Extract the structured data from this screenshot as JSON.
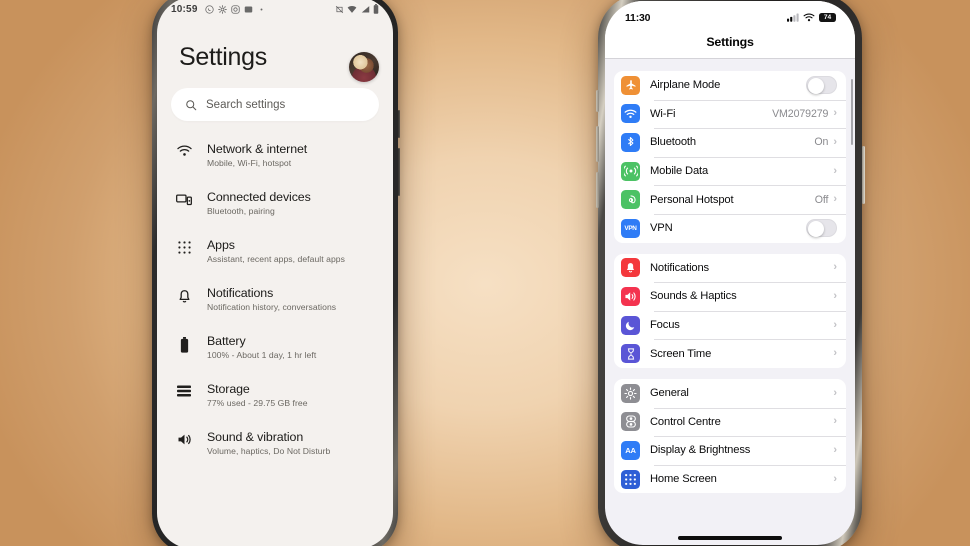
{
  "background": {
    "accent": "#cc935c",
    "center": "#f5ddc0"
  },
  "android": {
    "status_bar": {
      "time": "10:59",
      "notification_icons": [
        "whatsapp-icon",
        "settings-gear-icon",
        "instagram-icon",
        "app-icon",
        "more-dot-icon"
      ],
      "right_icons": [
        "vibrate-off-icon",
        "wifi-icon",
        "signal-icon",
        "battery-icon"
      ]
    },
    "avatar": "user-avatar",
    "title": "Settings",
    "search": {
      "placeholder": "Search settings",
      "icon": "search-icon"
    },
    "items": [
      {
        "icon": "wifi-icon",
        "title": "Network & internet",
        "subtitle": "Mobile, Wi-Fi, hotspot"
      },
      {
        "icon": "devices-icon",
        "title": "Connected devices",
        "subtitle": "Bluetooth, pairing"
      },
      {
        "icon": "apps-grid-icon",
        "title": "Apps",
        "subtitle": "Assistant, recent apps, default apps"
      },
      {
        "icon": "bell-icon",
        "title": "Notifications",
        "subtitle": "Notification history, conversations"
      },
      {
        "icon": "battery-icon",
        "title": "Battery",
        "subtitle": "100% - About 1 day, 1 hr left"
      },
      {
        "icon": "storage-icon",
        "title": "Storage",
        "subtitle": "77% used - 29.75 GB free"
      },
      {
        "icon": "volume-icon",
        "title": "Sound & vibration",
        "subtitle": "Volume, haptics, Do Not Disturb"
      }
    ]
  },
  "iphone": {
    "status_bar": {
      "time": "11:30",
      "signal_icon": "cellular-signal-icon",
      "wifi_icon": "wifi-icon",
      "battery_level": "74"
    },
    "nav_title": "Settings",
    "groups": [
      {
        "rows": [
          {
            "icon": "airplane-icon",
            "icon_color": "#ef9035",
            "label": "Airplane Mode",
            "control": "toggle",
            "value": "",
            "state": "off"
          },
          {
            "icon": "wifi-icon",
            "icon_color": "#2f7cf6",
            "label": "Wi-Fi",
            "control": "chevron",
            "value": "VM2079279"
          },
          {
            "icon": "bluetooth-icon",
            "icon_color": "#2f7cf6",
            "label": "Bluetooth",
            "control": "chevron",
            "value": "On"
          },
          {
            "icon": "mobile-data-icon",
            "icon_color": "#4cc265",
            "label": "Mobile Data",
            "control": "chevron",
            "value": ""
          },
          {
            "icon": "personal-hotspot-icon",
            "icon_color": "#4cc265",
            "label": "Personal Hotspot",
            "control": "chevron",
            "value": "Off"
          },
          {
            "icon": "vpn-icon",
            "icon_color": "#2f7cf6",
            "label": "VPN",
            "control": "toggle",
            "value": "",
            "state": "off"
          }
        ]
      },
      {
        "rows": [
          {
            "icon": "notifications-bell-icon",
            "icon_color": "#f4383c",
            "label": "Notifications",
            "control": "chevron",
            "value": ""
          },
          {
            "icon": "sounds-haptics-icon",
            "icon_color": "#f4334f",
            "label": "Sounds & Haptics",
            "control": "chevron",
            "value": ""
          },
          {
            "icon": "focus-moon-icon",
            "icon_color": "#5a55d6",
            "label": "Focus",
            "control": "chevron",
            "value": ""
          },
          {
            "icon": "screen-time-icon",
            "icon_color": "#5a55d6",
            "label": "Screen Time",
            "control": "chevron",
            "value": ""
          }
        ]
      },
      {
        "rows": [
          {
            "icon": "general-gear-icon",
            "icon_color": "#8e8e93",
            "label": "General",
            "control": "chevron",
            "value": ""
          },
          {
            "icon": "control-centre-icon",
            "icon_color": "#8e8e93",
            "label": "Control Centre",
            "control": "chevron",
            "value": ""
          },
          {
            "icon": "display-brightness-icon",
            "icon_color": "#2f7cf6",
            "label": "Display & Brightness",
            "control": "chevron",
            "value": "",
            "glyph": "AA"
          },
          {
            "icon": "home-screen-icon",
            "icon_color": "#2f5fd6",
            "label": "Home Screen",
            "control": "chevron",
            "value": ""
          }
        ]
      }
    ],
    "chevron_glyph": "›"
  }
}
